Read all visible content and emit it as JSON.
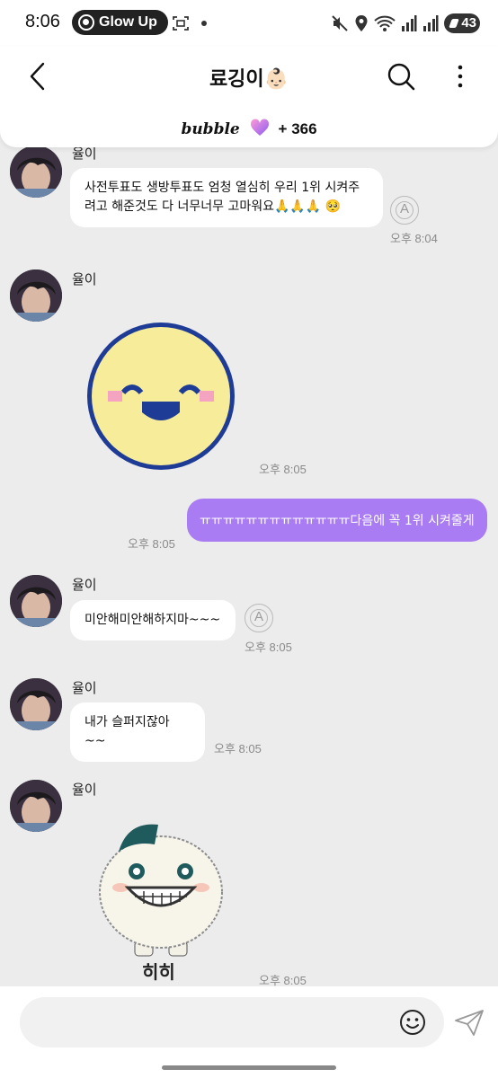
{
  "status_bar": {
    "time": "8:06",
    "pill_label": "Glow Up",
    "battery": "43"
  },
  "header": {
    "title": "료깅이👶🏻",
    "bubble_logo": "bubble",
    "bubble_count": "+ 366",
    "accent": "#a97cf3"
  },
  "messages": [
    {
      "sender": "율이",
      "text": "사전투표도 생방투표도 엄청 열심히 우리 1위 시켜주려고 해준것도 다 너무너무 고마워요🙏🙏🙏 🥺",
      "time": "오후 8:04"
    },
    {
      "sender": "율이",
      "sticker": "pixel-smiley",
      "time": "오후 8:05"
    },
    {
      "mine": true,
      "text": "ㅠㅠㅠㅠㅠㅠㅠㅠㅠㅠㅠㅠㅠ다음에 꼭 1위 시켜줄게",
      "time": "오후 8:05"
    },
    {
      "sender": "율이",
      "text": "미안해미안해하지마~~~",
      "time": "오후 8:05"
    },
    {
      "sender": "율이",
      "text": "내가 슬퍼지잖아~~",
      "time": "오후 8:05"
    },
    {
      "sender": "율이",
      "sticker": "rice-cake-character",
      "sticker_caption": "히히",
      "time": "오후 8:05"
    }
  ],
  "input": {
    "placeholder": ""
  }
}
